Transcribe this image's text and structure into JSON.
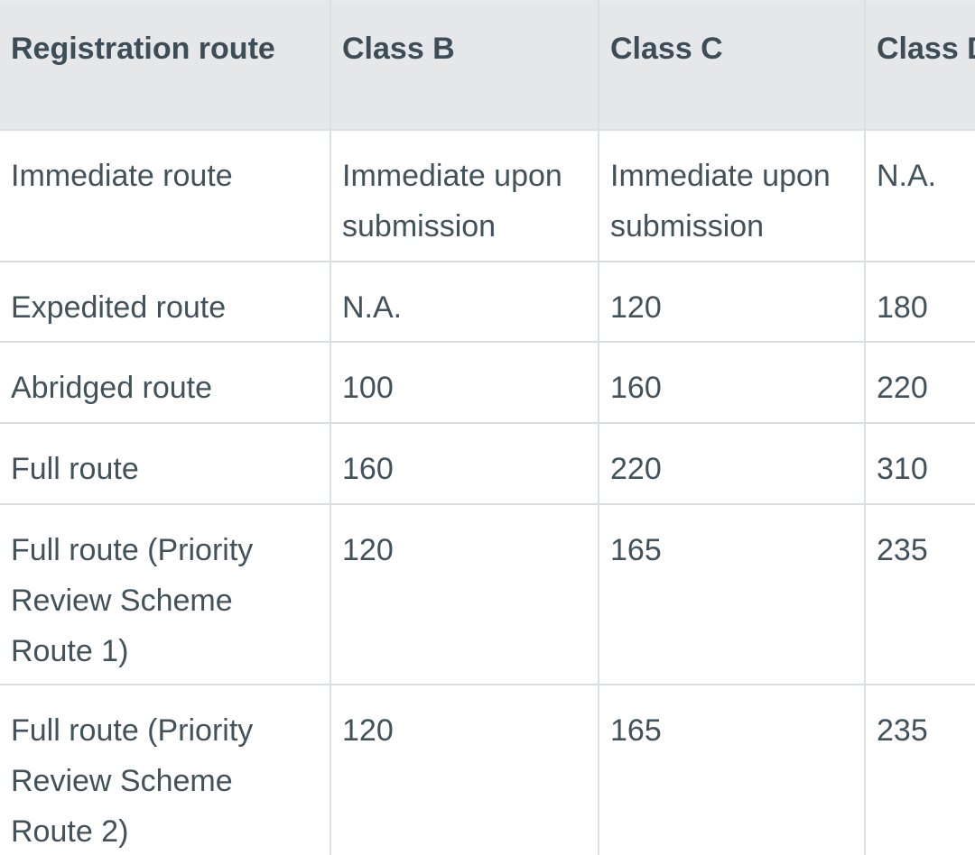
{
  "table": {
    "name": "registration-route-fee-table",
    "columns": [
      {
        "key": "route",
        "label": "Registration route"
      },
      {
        "key": "class_b",
        "label": "Class B"
      },
      {
        "key": "class_c",
        "label": "Class C"
      },
      {
        "key": "class_d",
        "label": "Class D"
      }
    ],
    "rows": [
      {
        "route": "Immediate route",
        "class_b": "Immediate upon submission",
        "class_c": "Immediate upon submission",
        "class_d": "N.A."
      },
      {
        "route": "Expedited route",
        "class_b": "N.A.",
        "class_c": "120",
        "class_d": "180"
      },
      {
        "route": "Abridged route",
        "class_b": "100",
        "class_c": "160",
        "class_d": "220"
      },
      {
        "route": "Full route",
        "class_b": "160",
        "class_c": "220",
        "class_d": "310"
      },
      {
        "route": "Full route (Priority Review Scheme Route 1)",
        "class_b": "120",
        "class_c": "165",
        "class_d": "235"
      },
      {
        "route": "Full route (Priority Review Scheme Route 2)",
        "class_b": "120",
        "class_c": "165",
        "class_d": "235"
      }
    ]
  },
  "style": {
    "header_background": "#e6e7e8",
    "header_text_color": "#3d4d57",
    "body_text_color": "#42525b",
    "border_color": "#d9dddf",
    "divider_color": "#dcdfe1",
    "body_background": "#ffffff"
  }
}
